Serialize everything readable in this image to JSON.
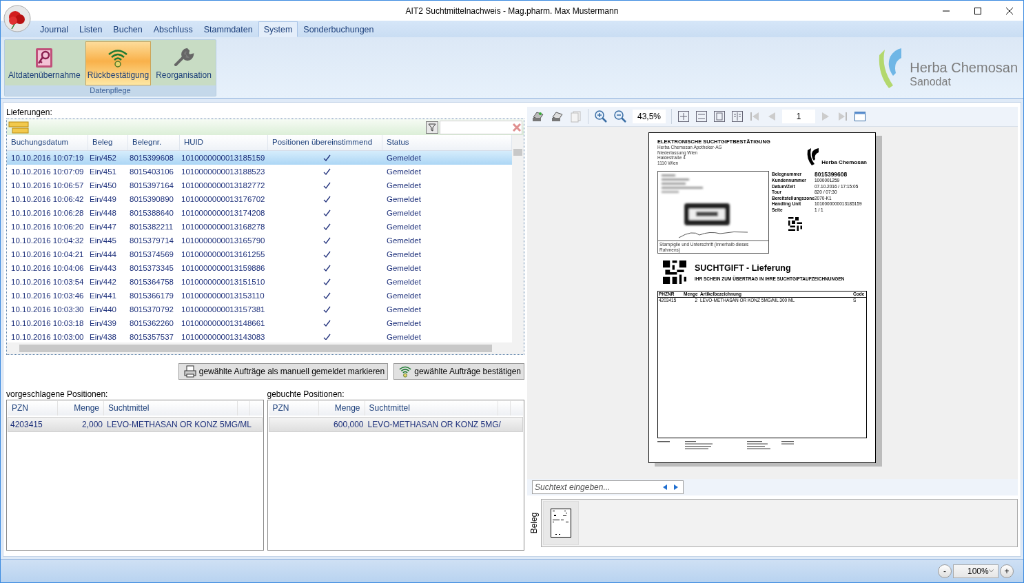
{
  "window": {
    "title": "AIT2 Suchtmittelnachweis - Mag.pharm. Max Mustermann"
  },
  "menu_tabs": [
    {
      "label": "Journal",
      "selected": false
    },
    {
      "label": "Listen",
      "selected": false
    },
    {
      "label": "Buchen",
      "selected": false
    },
    {
      "label": "Abschluss",
      "selected": false
    },
    {
      "label": "Stammdaten",
      "selected": false
    },
    {
      "label": "System",
      "selected": true
    },
    {
      "label": "Sonderbuchungen",
      "selected": false
    }
  ],
  "ribbon": {
    "group": "Datenpflege",
    "buttons": [
      {
        "label": "Altdatenübernahme",
        "selected": false
      },
      {
        "label": "Rückbestätigung",
        "selected": true
      },
      {
        "label": "Reorganisation",
        "selected": false
      }
    ]
  },
  "logo": {
    "name": "Herba Chemosan",
    "subtitle": "Sanodat"
  },
  "deliveries": {
    "label": "Lieferungen:",
    "columns": [
      "Buchungsdatum",
      "Beleg",
      "Belegnr.",
      "HUID",
      "Positionen übereinstimmend",
      "Status"
    ],
    "rows": [
      {
        "date": "10.10.2016 10:07:19",
        "beleg": "Ein/452",
        "belegnr": "8015399608",
        "huid": "1010000000013185159",
        "match": true,
        "status": "Gemeldet",
        "selected": true
      },
      {
        "date": "10.10.2016 10:07:09",
        "beleg": "Ein/451",
        "belegnr": "8015403106",
        "huid": "1010000000013188523",
        "match": true,
        "status": "Gemeldet",
        "selected": false
      },
      {
        "date": "10.10.2016 10:06:57",
        "beleg": "Ein/450",
        "belegnr": "8015397164",
        "huid": "1010000000013182772",
        "match": true,
        "status": "Gemeldet",
        "selected": false
      },
      {
        "date": "10.10.2016 10:06:42",
        "beleg": "Ein/449",
        "belegnr": "8015390890",
        "huid": "1010000000013176702",
        "match": true,
        "status": "Gemeldet",
        "selected": false
      },
      {
        "date": "10.10.2016 10:06:28",
        "beleg": "Ein/448",
        "belegnr": "8015388640",
        "huid": "1010000000013174208",
        "match": true,
        "status": "Gemeldet",
        "selected": false
      },
      {
        "date": "10.10.2016 10:06:20",
        "beleg": "Ein/447",
        "belegnr": "8015382211",
        "huid": "1010000000013168278",
        "match": true,
        "status": "Gemeldet",
        "selected": false
      },
      {
        "date": "10.10.2016 10:04:32",
        "beleg": "Ein/445",
        "belegnr": "8015379714",
        "huid": "1010000000013165790",
        "match": true,
        "status": "Gemeldet",
        "selected": false
      },
      {
        "date": "10.10.2016 10:04:21",
        "beleg": "Ein/444",
        "belegnr": "8015374569",
        "huid": "1010000000013161255",
        "match": true,
        "status": "Gemeldet",
        "selected": false
      },
      {
        "date": "10.10.2016 10:04:06",
        "beleg": "Ein/443",
        "belegnr": "8015373345",
        "huid": "1010000000013159886",
        "match": true,
        "status": "Gemeldet",
        "selected": false
      },
      {
        "date": "10.10.2016 10:03:54",
        "beleg": "Ein/442",
        "belegnr": "8015364758",
        "huid": "1010000000013151510",
        "match": true,
        "status": "Gemeldet",
        "selected": false
      },
      {
        "date": "10.10.2016 10:03:46",
        "beleg": "Ein/441",
        "belegnr": "8015366179",
        "huid": "1010000000013153110",
        "match": true,
        "status": "Gemeldet",
        "selected": false
      },
      {
        "date": "10.10.2016 10:03:30",
        "beleg": "Ein/440",
        "belegnr": "8015370792",
        "huid": "1010000000013157381",
        "match": true,
        "status": "Gemeldet",
        "selected": false
      },
      {
        "date": "10.10.2016 10:03:18",
        "beleg": "Ein/439",
        "belegnr": "8015362260",
        "huid": "1010000000013148661",
        "match": true,
        "status": "Gemeldet",
        "selected": false
      },
      {
        "date": "10.10.2016 10:03:00",
        "beleg": "Ein/438",
        "belegnr": "8015357537",
        "huid": "1010000000013143083",
        "match": true,
        "status": "Gemeldet",
        "selected": false
      }
    ]
  },
  "actions": [
    {
      "label": "gewählte Aufträge als manuell gemeldet markieren"
    },
    {
      "label": "gewählte Aufträge bestätigen"
    }
  ],
  "proposed": {
    "label": "vorgeschlagene Positionen:",
    "columns": [
      "PZN",
      "Menge",
      "Suchtmittel"
    ],
    "rows": [
      {
        "pzn": "4203415",
        "menge": "2,000",
        "name": "LEVO-METHASAN OR KONZ 5MG/ML"
      }
    ]
  },
  "booked": {
    "label": "gebuchte Positionen:",
    "columns": [
      "PZN",
      "Menge",
      "Suchtmittel"
    ],
    "rows": [
      {
        "menge": "600,000",
        "name": "LEVO-METHASAN OR KONZ 5MG/"
      }
    ]
  },
  "viewer": {
    "zoom": "43,5%",
    "page": "1",
    "search_placeholder": "Suchtext eingeben...",
    "thumbnails_label": "Beleg",
    "document": {
      "title": "ELEKTRONISCHE  SUCHTGIFTBESTÄTIGUNG",
      "sender": [
        "Herba Chemosan Apotheker-AG",
        "Niederlassung Wien",
        "Haidestraße 4",
        "1110 Wien"
      ],
      "logo": "Herba Chemosan",
      "stamp_caption": "Stampiglie und Unterschrift (innerhalb dieses Rahmens)",
      "info": [
        {
          "label": "Belegnummer",
          "value": "8015399608"
        },
        {
          "label": "Kundennummer",
          "value": "1000001259"
        },
        {
          "label": "Datum/Zeit",
          "value": "07.10.2016 / 17:15:05"
        },
        {
          "label": "Tour",
          "value": "820 / 07:30"
        },
        {
          "label": "Bereitstellungszone",
          "value": "2070-K1"
        },
        {
          "label": "Handling Unit",
          "value": "1010000000013185159"
        },
        {
          "label": "Seite",
          "value": "1  /  1"
        }
      ],
      "heading": "SUCHTGIFT - Lieferung",
      "subheading": "IHR SCHEIN ZUM ÜBERTRAG IN IHRE SUCHTGIFTAUFZEICHNUNGEN",
      "columns": [
        "PHZNR",
        "Menge",
        "Artikelbezeichnung",
        "Code"
      ],
      "rows": [
        {
          "pzn": "4203415",
          "menge": "2",
          "name": "LEVO-METHASAN OR KONZ 5MG/ML 300 ML",
          "code": "S"
        }
      ]
    }
  },
  "status_bar": {
    "zoom": "100%",
    "minus": "-",
    "plus": "+"
  }
}
